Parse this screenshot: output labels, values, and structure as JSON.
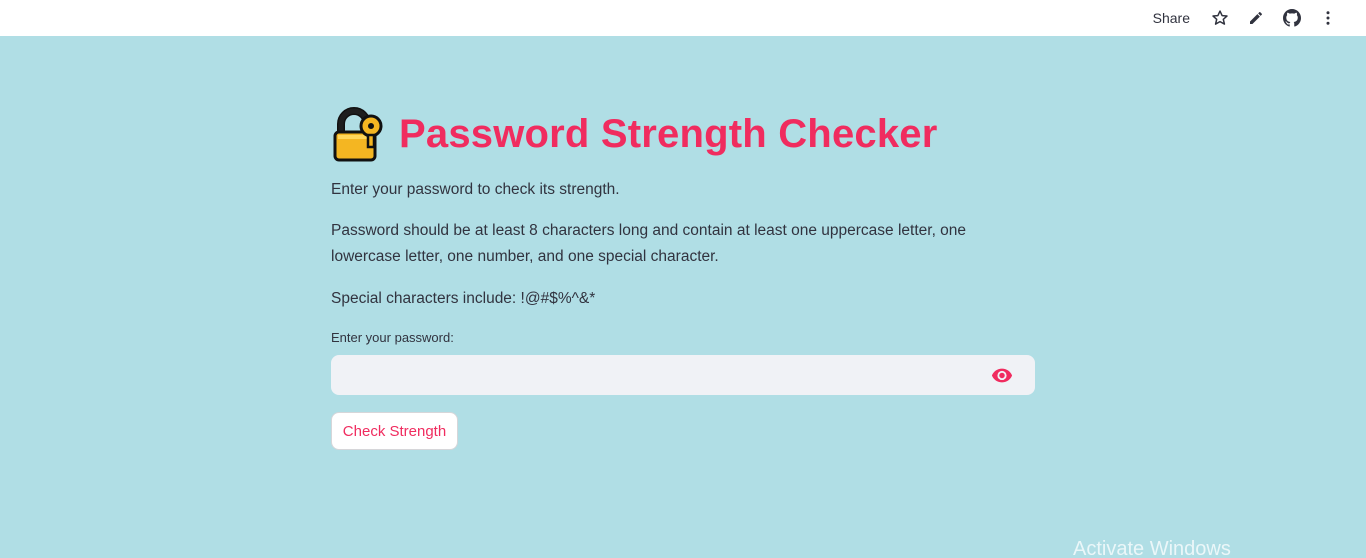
{
  "topbar": {
    "share_label": "Share",
    "icons": [
      "star-icon",
      "pencil-icon",
      "github-icon",
      "more-vertical-icon"
    ]
  },
  "main": {
    "title": "Password Strength Checker",
    "title_emoji": "lock-with-key-icon",
    "intro": "Enter your password to check its strength.",
    "requirements": "Password should be at least 8 characters long and contain at least one uppercase letter, one lowercase letter, one number, and one special character.",
    "special_chars": "Special characters include: !@#$%^&*",
    "password_label": "Enter your password:",
    "password_value": "",
    "check_button": "Check Strength"
  },
  "watermark": "Activate Windows",
  "colors": {
    "background": "#b0dee5",
    "accent": "#f02c5f",
    "input_bg": "#f0f2f6",
    "text": "#31333f"
  }
}
